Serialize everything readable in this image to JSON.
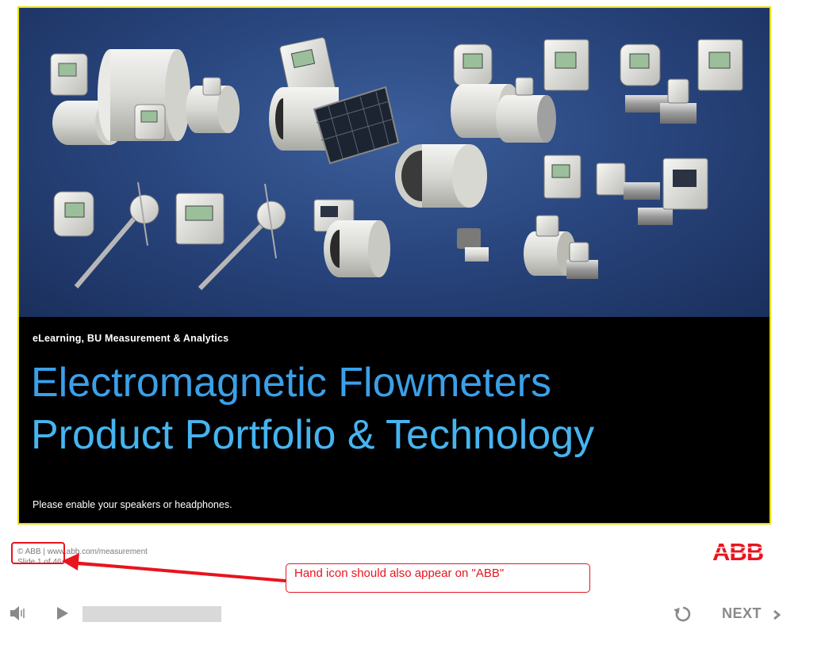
{
  "slide": {
    "subtitle": "eLearning, BU Measurement & Analytics",
    "title_line1": "Electromagnetic Flowmeters",
    "title_line2": "Product Portfolio & Technology",
    "notice": "Please enable your speakers or headphones.",
    "hero_image": "electromagnetic-flowmeter-products-photo"
  },
  "footer": {
    "copyright": "© ABB | www.abb.com/measurement",
    "slide_counter": "Slide 1 of 46",
    "logo_text": "ABB"
  },
  "annotation": {
    "callout_text": "Hand icon should also appear on \"ABB\""
  },
  "player": {
    "volume_icon": "speaker-icon",
    "play_icon": "play-icon",
    "progress": 0.0,
    "replay_icon": "replay-icon",
    "next_label": "NEXT",
    "next_icon": "chevron-right-icon"
  },
  "colors": {
    "title_blue": "#3aa0e8",
    "slide_border": "#e8e000",
    "abb_red": "#e8141e",
    "annotation_red": "#e8141e"
  }
}
